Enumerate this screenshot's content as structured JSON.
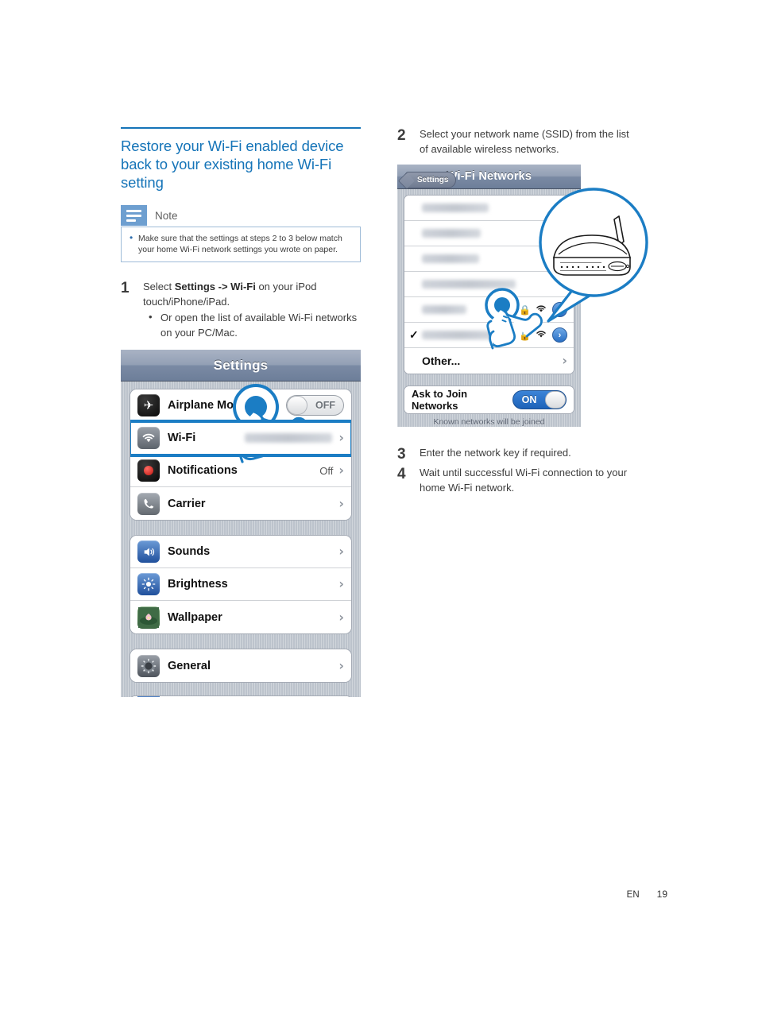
{
  "page": {
    "language_code": "EN",
    "page_number": "19"
  },
  "left_column": {
    "heading": "Restore your Wi-Fi enabled device back to your existing home Wi-Fi setting",
    "note": {
      "icon": "note-lines-icon",
      "title": "Note",
      "bullets": [
        "Make sure that the settings at steps 2 to 3 below match your home Wi-Fi network settings you wrote on paper."
      ]
    },
    "step1": {
      "number": "1",
      "text_before": "Select ",
      "bold": "Settings -> Wi-Fi",
      "text_after": " on your iPod touch/iPhone/iPad.",
      "sub_bullets": [
        "Or open the list of available Wi-Fi networks on your PC/Mac."
      ]
    },
    "settings_screen": {
      "nav_title": "Settings",
      "groups": [
        {
          "rows": [
            {
              "icon": "airplane-icon",
              "label": "Airplane Mode",
              "control": "toggle",
              "toggle_state": "OFF",
              "toggle_label": "OFF"
            },
            {
              "icon": "wifi-icon",
              "label": "Wi-Fi",
              "control": "value-chevron",
              "value": "[redacted network name]",
              "redacted": true,
              "highlighted": true
            },
            {
              "icon": "notifications-icon",
              "label": "Notifications",
              "control": "value-chevron",
              "value": "Off"
            },
            {
              "icon": "carrier-icon",
              "label": "Carrier",
              "control": "chevron",
              "value": ""
            }
          ]
        },
        {
          "rows": [
            {
              "icon": "sounds-icon",
              "label": "Sounds",
              "control": "chevron",
              "value": ""
            },
            {
              "icon": "brightness-icon",
              "label": "Brightness",
              "control": "chevron",
              "value": ""
            },
            {
              "icon": "wallpaper-icon",
              "label": "Wallpaper",
              "control": "chevron",
              "value": ""
            }
          ]
        },
        {
          "rows": [
            {
              "icon": "general-icon",
              "label": "General",
              "control": "chevron",
              "value": ""
            }
          ]
        }
      ]
    }
  },
  "right_column": {
    "step2": {
      "number": "2",
      "text": "Select your network name (SSID) from the list of available wireless networks."
    },
    "wifi_screen": {
      "back_button": "Settings",
      "nav_title": "Wi-Fi Networks",
      "networks": [
        {
          "ssid": "[redacted network name]",
          "redacted": true,
          "selected": false,
          "secured": false,
          "signal": ""
        },
        {
          "ssid": "[redacted network name]",
          "redacted": true,
          "selected": false,
          "secured": false,
          "signal": ""
        },
        {
          "ssid": "[redacted network name]",
          "redacted": true,
          "selected": false,
          "secured": false,
          "signal": ""
        },
        {
          "ssid": "[redacted network name]",
          "redacted": true,
          "selected": false,
          "secured": false,
          "signal": ""
        },
        {
          "ssid": "[redacted network name]",
          "redacted": true,
          "selected": false,
          "secured": true,
          "signal": "wifi-signal-icon"
        },
        {
          "ssid": "[redacted network name]",
          "redacted": true,
          "selected": true,
          "secured": true,
          "signal": "wifi-signal-icon"
        }
      ],
      "other_row_label": "Other...",
      "ask_to_join": {
        "label": "Ask to Join Networks",
        "toggle_state": "ON",
        "toggle_label": "ON"
      },
      "footnote": "Known networks will be joined automatically.  If no known networks are available, you will be asked before joining a new network.",
      "callout": {
        "icon": "wireless-router-icon",
        "caption": ""
      }
    },
    "step3": {
      "number": "3",
      "text": "Enter the network key if required."
    },
    "step4": {
      "number": "4",
      "text": "Wait until successful Wi-Fi connection to your home Wi-Fi network."
    }
  },
  "colors": {
    "heading_blue": "#1574b8",
    "highlight_blue": "#1b7dc4",
    "note_icon_blue": "#6e9fd0",
    "note_border": "#9fbcd8",
    "ios_chrome": "#6d7e99",
    "toggle_on": "#2a6fc4"
  }
}
